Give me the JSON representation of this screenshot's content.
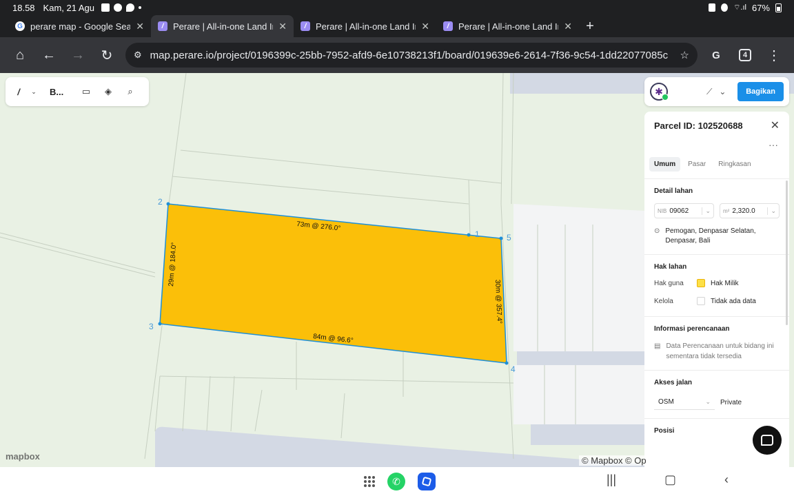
{
  "status": {
    "time": "18.58",
    "date": "Kam, 21 Agu",
    "battery": "67%"
  },
  "tabs": [
    {
      "label": "perare map - Google Search",
      "favicon": "google-icon",
      "active": false
    },
    {
      "label": "Perare | All-in-one Land Info",
      "favicon": "perare-icon",
      "active": true
    },
    {
      "label": "Perare | All-in-one Land Info",
      "favicon": "perare-icon",
      "active": false
    },
    {
      "label": "Perare | All-in-one Land Info",
      "favicon": "perare-icon",
      "active": false
    }
  ],
  "toolbar": {
    "url": "map.perare.io/project/0196399c-25bb-7952-afd9-6e10738213f1/board/019639e6-2614-7f36-9c54-1dd22077085c",
    "tab_count": "4"
  },
  "map_toolbar": {
    "board_name": "B..."
  },
  "share_label": "Bagikan",
  "parcel": {
    "title": "Parcel ID: 102520688",
    "vertex_labels": [
      "1",
      "2",
      "3",
      "4",
      "5"
    ],
    "edge_labels": [
      "73m @ 276.0°",
      "29m @ 184.0°",
      "84m @ 96.6°",
      "30m @ 357.4°"
    ],
    "fill_color": "#fbbf09",
    "stroke_color": "#1d8fd8"
  },
  "panel": {
    "tabs": [
      "Umum",
      "Pasar",
      "Ringkasan"
    ],
    "detail_lahan": {
      "heading": "Detail lahan",
      "nib_prefix": "NIB",
      "nib_value": "09062",
      "area_prefix": "m²",
      "area_value": "2,320.0",
      "address": "Pemogan, Denpasar Selatan, Denpasar, Bali"
    },
    "hak_lahan": {
      "heading": "Hak lahan",
      "hak_guna_label": "Hak guna",
      "hak_guna_value": "Hak Milik",
      "kelola_label": "Kelola",
      "kelola_value": "Tidak ada data"
    },
    "perencanaan": {
      "heading": "Informasi perencanaan",
      "note": "Data Perencanaan untuk bidang ini sementara tidak tersedia"
    },
    "akses_jalan": {
      "heading": "Akses jalan",
      "source": "OSM",
      "type": "Private"
    },
    "posisi": {
      "heading": "Posisi"
    }
  },
  "map": {
    "logo": "mapbox",
    "attribution": "© Mapbox © Op"
  }
}
